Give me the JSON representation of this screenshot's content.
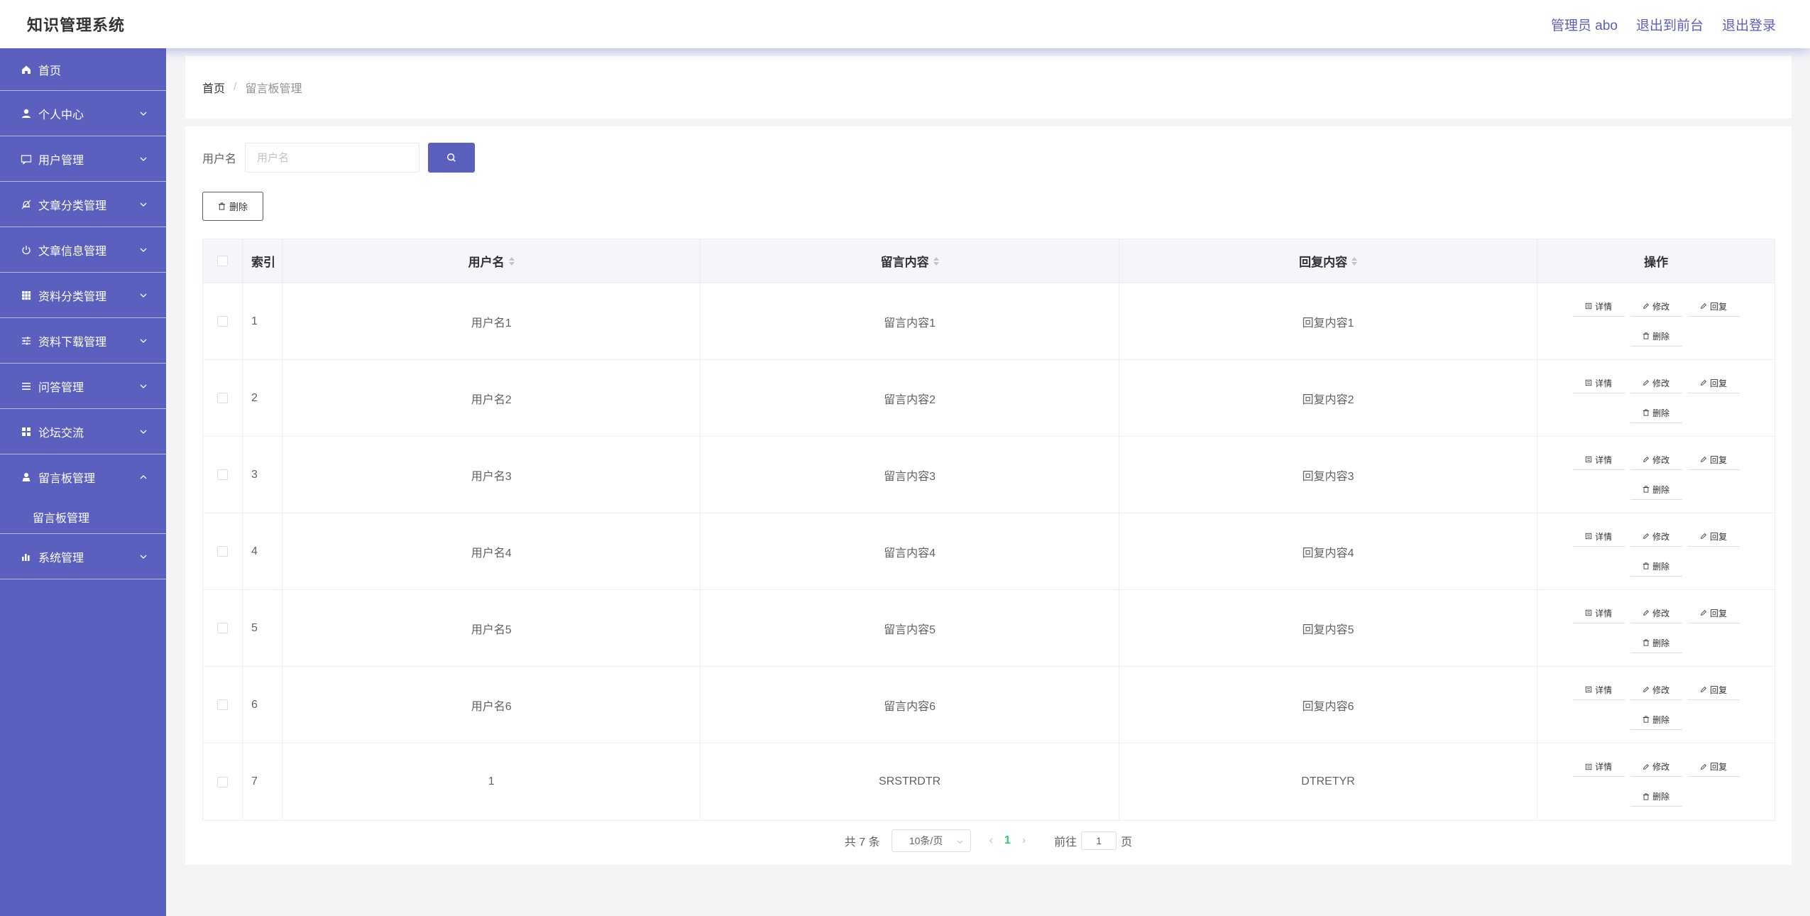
{
  "header": {
    "title": "知识管理系统",
    "user": "管理员 abo",
    "to_front": "退出到前台",
    "logout": "退出登录"
  },
  "colors": {
    "accent": "#5b5fbe",
    "page_number": "#2ecc71"
  },
  "sidebar": {
    "items": [
      {
        "label": "首页",
        "icon": "home-icon"
      },
      {
        "label": "个人中心",
        "icon": "user-icon"
      },
      {
        "label": "用户管理",
        "icon": "message-icon"
      },
      {
        "label": "文章分类管理",
        "icon": "bell-off-icon"
      },
      {
        "label": "文章信息管理",
        "icon": "power-icon"
      },
      {
        "label": "资料分类管理",
        "icon": "grid-icon"
      },
      {
        "label": "资料下载管理",
        "icon": "sliders-icon"
      },
      {
        "label": "问答管理",
        "icon": "menu-icon"
      },
      {
        "label": "论坛交流",
        "icon": "apps-icon"
      },
      {
        "label": "留言板管理",
        "icon": "person-icon",
        "expanded": true,
        "sub": "留言板管理"
      },
      {
        "label": "系统管理",
        "icon": "chart-icon"
      }
    ]
  },
  "breadcrumb": {
    "home": "首页",
    "separator": "/",
    "current": "留言板管理"
  },
  "search": {
    "label": "用户名",
    "placeholder": "用户名"
  },
  "toolbar": {
    "delete_label": "删除"
  },
  "table": {
    "headers": {
      "index": "索引",
      "username": "用户名",
      "message": "留言内容",
      "reply": "回复内容",
      "ops": "操作"
    },
    "rows": [
      {
        "index": "1",
        "username": "用户名1",
        "message": "留言内容1",
        "reply": "回复内容1"
      },
      {
        "index": "2",
        "username": "用户名2",
        "message": "留言内容2",
        "reply": "回复内容2"
      },
      {
        "index": "3",
        "username": "用户名3",
        "message": "留言内容3",
        "reply": "回复内容3"
      },
      {
        "index": "4",
        "username": "用户名4",
        "message": "留言内容4",
        "reply": "回复内容4"
      },
      {
        "index": "5",
        "username": "用户名5",
        "message": "留言内容5",
        "reply": "回复内容5"
      },
      {
        "index": "6",
        "username": "用户名6",
        "message": "留言内容6",
        "reply": "回复内容6"
      },
      {
        "index": "7",
        "username": "1",
        "message": "SRSTRDTR",
        "reply": "DTRETYR"
      }
    ],
    "ops": {
      "detail": "详情",
      "edit": "修改",
      "reply": "回复",
      "delete": "删除"
    }
  },
  "pagination": {
    "total": "共 7 条",
    "page_size": "10条/页",
    "current_page": "1",
    "goto_label": "前往",
    "goto_value": "1",
    "page_suffix": "页"
  }
}
